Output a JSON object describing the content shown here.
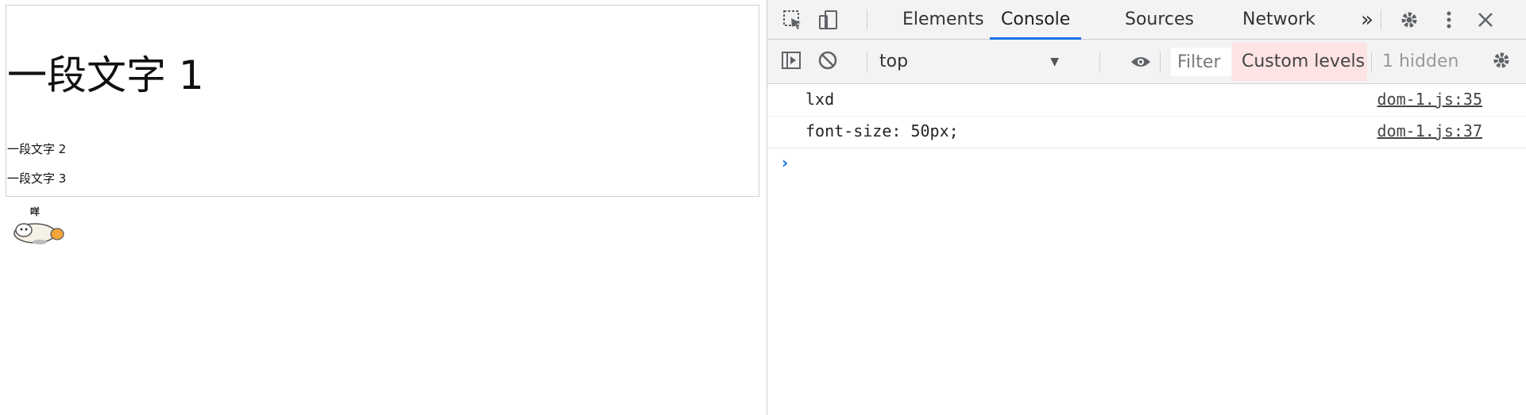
{
  "page": {
    "text_1": "一段文字 1",
    "text_2": "一段文字 2",
    "text_3": "一段文字 3",
    "sticker_caption": "咩"
  },
  "devtools": {
    "tabs": [
      {
        "label": "Elements"
      },
      {
        "label": "Console"
      },
      {
        "label": "Sources"
      },
      {
        "label": "Network"
      }
    ],
    "more_tabs": "»",
    "toolbar": {
      "context": "top",
      "filter_placeholder": "Filter",
      "levels": "Custom levels ▾",
      "hidden": "1 hidden"
    },
    "messages": [
      {
        "text": "lxd",
        "source": "dom-1.js:35"
      },
      {
        "text": "font-size: 50px;",
        "source": "dom-1.js:37"
      }
    ],
    "prompt": "›",
    "accent": "#1a73e8"
  }
}
